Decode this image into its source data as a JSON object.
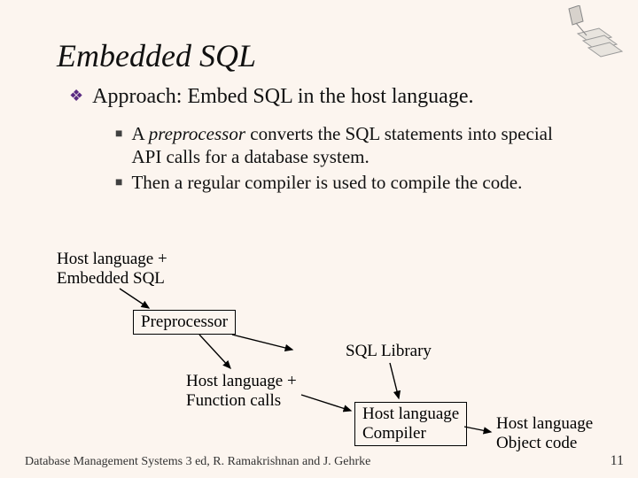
{
  "title": "Embedded SQL",
  "approach": "Approach: Embed SQL in the host language.",
  "bullets": {
    "b1a": "A ",
    "b1pre": "preprocessor",
    "b1b": " converts the SQL statements into special API calls for a database system.",
    "b2": "Then a regular compiler is used to compile the code."
  },
  "diagram": {
    "hostEmbed1": "Host language +",
    "hostEmbed2": "Embedded SQL",
    "preprocessor": "Preprocessor",
    "sqlLib": "SQL Library",
    "hostFunc1": "Host language +",
    "hostFunc2": "Function calls",
    "compiler1": "Host language",
    "compiler2": "Compiler",
    "obj1": "Host language",
    "obj2": "Object code"
  },
  "footer": "Database Management Systems 3 ed,  R. Ramakrishnan and J. Gehrke",
  "page": "11"
}
